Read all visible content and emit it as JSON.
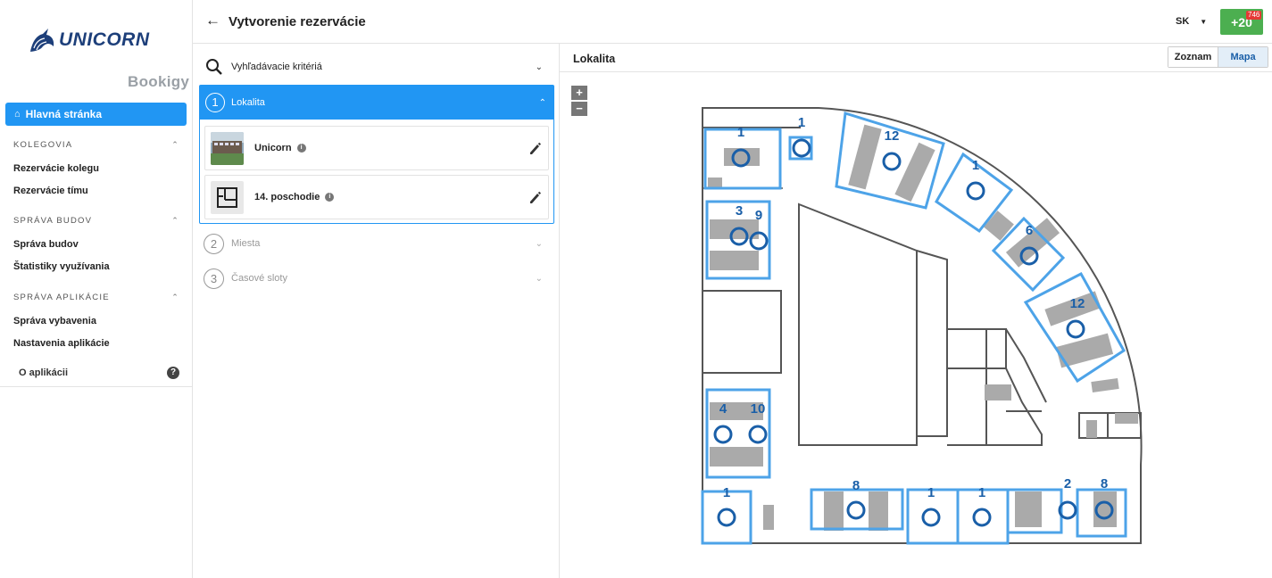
{
  "sidebar": {
    "brand": "UNICORN",
    "product": "Bookigy",
    "home_label": "Hlavná stránka",
    "sections": [
      {
        "title": "KOLEGOVIA",
        "items": [
          "Rezervácie kolegu",
          "Rezervácie tímu"
        ]
      },
      {
        "title": "SPRÁVA BUDOV",
        "items": [
          "Správa budov",
          "Štatistiky využívania"
        ]
      },
      {
        "title": "SPRÁVA APLIKÁCIE",
        "items": [
          "Správa vybavenia",
          "Nastavenia aplikácie"
        ]
      }
    ],
    "about_label": "O aplikácii"
  },
  "header": {
    "title": "Vytvorenie rezervácie",
    "language": "SK",
    "action_label": "+20",
    "badge_count": "746"
  },
  "search": {
    "criteria_label": "Vyhľadávacie kritériá",
    "steps": [
      {
        "number": "1",
        "label": "Lokalita",
        "active": true
      },
      {
        "number": "2",
        "label": "Miesta",
        "active": false
      },
      {
        "number": "3",
        "label": "Časové sloty",
        "active": false
      }
    ],
    "location_cards": [
      {
        "title": "Unicorn",
        "icon": "building-photo"
      },
      {
        "title": "14. poschodie",
        "icon": "floor-plan-icon"
      }
    ]
  },
  "map": {
    "title": "Lokalita",
    "view_tabs": [
      "Zoznam",
      "Mapa"
    ],
    "selected_view": "Mapa",
    "zoom_in": "+",
    "zoom_out": "−",
    "accent_color": "#2196f3",
    "zone_counts": [
      "1",
      "1",
      "12",
      "1",
      "3",
      "9",
      "6",
      "12",
      "4",
      "10",
      "1",
      "8",
      "1",
      "1",
      "2",
      "8"
    ]
  }
}
